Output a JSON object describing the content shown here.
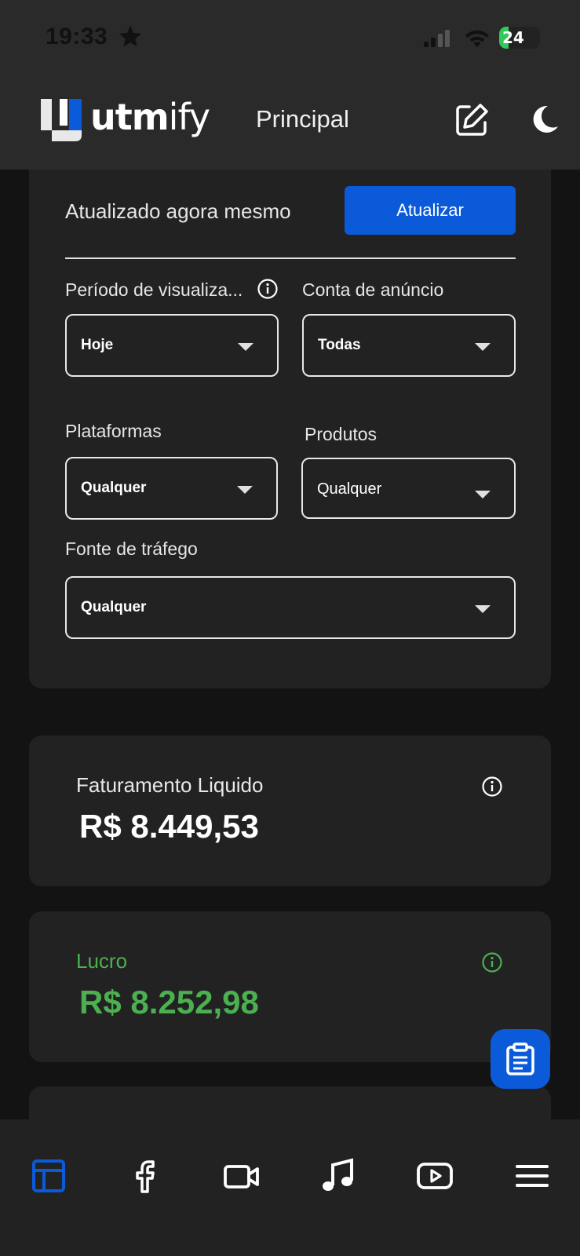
{
  "status_bar": {
    "time": "19:33",
    "battery": "24",
    "battery_level": 0.24
  },
  "header": {
    "logo_text_bold": "utm",
    "logo_text_light": "ify",
    "title": "Principal",
    "icons": [
      "edit-icon",
      "moon-icon"
    ]
  },
  "filters": {
    "updated_text": "Atualizado agora mesmo",
    "refresh_label": "Atualizar",
    "period": {
      "label": "Período de visualiza...",
      "value": "Hoje"
    },
    "ad_account": {
      "label": "Conta de anúncio",
      "value": "Todas"
    },
    "platforms": {
      "label": "Plataformas",
      "value": "Qualquer"
    },
    "products": {
      "label": "Produtos",
      "value": "Qualquer"
    },
    "traffic_source": {
      "label": "Fonte de tráfego",
      "value": "Qualquer"
    }
  },
  "metrics": [
    {
      "label": "Faturamento Liquido",
      "value": "R$ 8.449,53"
    },
    {
      "label": "Lucro",
      "value": "R$ 8.252,98"
    }
  ],
  "colors": {
    "accent": "#0b5ad9",
    "profit": "#4caf50",
    "card": "#222222",
    "background": "#131313"
  },
  "bottom_nav": [
    "dashboard-icon",
    "facebook-icon",
    "video-icon",
    "music-icon",
    "youtube-icon",
    "menu-icon"
  ]
}
